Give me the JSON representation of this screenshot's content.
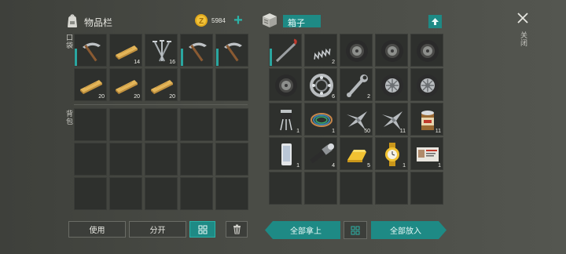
{
  "left_panel": {
    "title": "物品栏",
    "coins": "5984",
    "add_label": "+",
    "pocket_label": "口袋",
    "backpack_label": "背包",
    "pocket_slots": [
      {
        "icon": "pickaxe-icon",
        "count": ""
      },
      {
        "icon": "wood-plank-icon",
        "count": "14"
      },
      {
        "icon": "nails-icon",
        "count": "16"
      },
      {
        "icon": "pickaxe-icon",
        "count": ""
      },
      {
        "icon": "pickaxe-icon",
        "count": ""
      },
      {
        "icon": "wood-plank-icon",
        "count": "20"
      },
      {
        "icon": "wood-plank-icon",
        "count": "20"
      },
      {
        "icon": "wood-plank-icon",
        "count": "20"
      },
      {
        "icon": "",
        "count": ""
      },
      {
        "icon": "",
        "count": ""
      }
    ]
  },
  "right_panel": {
    "title": "箱子",
    "close_label": "关闭",
    "slots": [
      {
        "icon": "crowbar-icon",
        "count": ""
      },
      {
        "icon": "spring-icon",
        "count": "2"
      },
      {
        "icon": "tire-icon",
        "count": ""
      },
      {
        "icon": "tire-icon",
        "count": ""
      },
      {
        "icon": "tire-icon",
        "count": ""
      },
      {
        "icon": "tire-icon",
        "count": ""
      },
      {
        "icon": "bearing-icon",
        "count": "6"
      },
      {
        "icon": "wrench-icon",
        "count": "2"
      },
      {
        "icon": "wheel-rim-icon",
        "count": ""
      },
      {
        "icon": "wheel-rim-icon",
        "count": ""
      },
      {
        "icon": "transistor-icon",
        "count": "1"
      },
      {
        "icon": "wire-coil-icon",
        "count": "1"
      },
      {
        "icon": "metal-scrap-icon",
        "count": "50"
      },
      {
        "icon": "metal-scrap-icon",
        "count": "11"
      },
      {
        "icon": "tin-can-icon",
        "count": "11"
      },
      {
        "icon": "phone-icon",
        "count": "1"
      },
      {
        "icon": "flashlight-icon",
        "count": "4"
      },
      {
        "icon": "gold-bar-icon",
        "count": "5"
      },
      {
        "icon": "gold-watch-icon",
        "count": "1"
      },
      {
        "icon": "id-card-icon",
        "count": "1"
      }
    ]
  },
  "bottom": {
    "use_label": "使用",
    "split_label": "分开",
    "take_all_label": "全部拿上",
    "put_all_label": "全部放入"
  },
  "colors": {
    "accent": "#1e8a85",
    "slot": "#2e302d",
    "coin": "#e0a81c"
  }
}
